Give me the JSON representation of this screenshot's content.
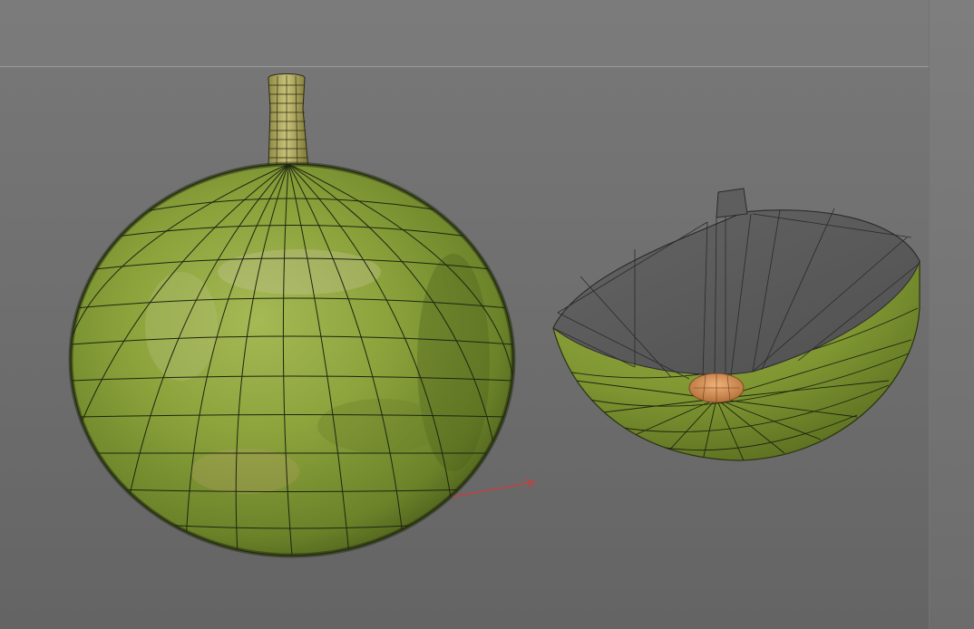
{
  "scene": {
    "objects": [
      {
        "name": "whole-fruit"
      },
      {
        "name": "half-fruit"
      },
      {
        "name": "x-axis-gizmo"
      }
    ]
  },
  "colors": {
    "background_top": "#7b7b7b",
    "background_bottom": "#646464",
    "fruit_skin": "#8ca33c",
    "fruit_skin_dark": "#556b1e",
    "wireframe": "#1e2410",
    "cut_face": "#5a5a5a",
    "seed": "#d9955a",
    "axis": "#d23a3a"
  }
}
